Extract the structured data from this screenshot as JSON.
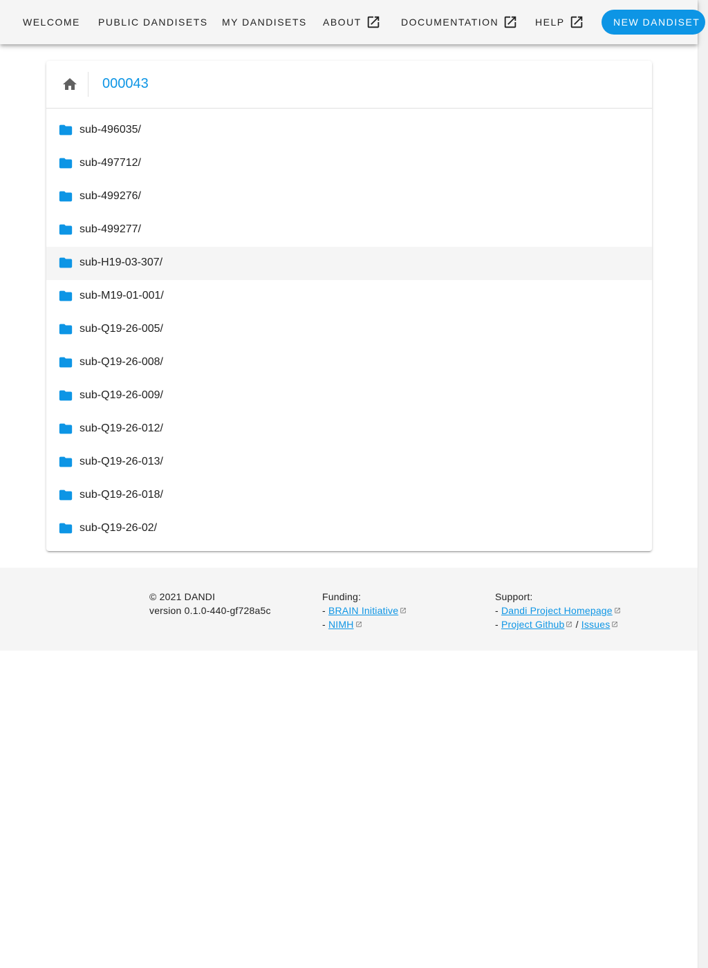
{
  "nav": {
    "items": [
      {
        "label": "WELCOME",
        "external": false
      },
      {
        "label": "PUBLIC DANDISETS",
        "external": false
      },
      {
        "label": "MY DANDISETS",
        "external": false
      },
      {
        "label": "ABOUT",
        "external": true
      },
      {
        "label": "DOCUMENTATION",
        "external": true
      },
      {
        "label": "HELP",
        "external": true
      }
    ],
    "new_dandiset_label": "NEW DANDISET"
  },
  "browser": {
    "breadcrumb": "000043",
    "items": [
      "sub-496035/",
      "sub-497712/",
      "sub-499276/",
      "sub-499277/",
      "sub-H19-03-307/",
      "sub-M19-01-001/",
      "sub-Q19-26-005/",
      "sub-Q19-26-008/",
      "sub-Q19-26-009/",
      "sub-Q19-26-012/",
      "sub-Q19-26-013/",
      "sub-Q19-26-018/",
      "sub-Q19-26-02/"
    ],
    "hovered_item": "sub-H19-03-307/"
  },
  "footer": {
    "copyright": "© 2021 DANDI",
    "version": "version 0.1.0-440-gf728a5c",
    "funding_title": "Funding:",
    "funding_links": [
      "BRAIN Initiative",
      "NIMH"
    ],
    "support_title": "Support:",
    "support_homepage": "Dandi Project Homepage",
    "support_github": "Project Github",
    "support_separator": "/",
    "support_issues": "Issues",
    "bullet": "-"
  },
  "colors": {
    "accent": "#0d95e5",
    "appbar_bg": "#f5f5f5",
    "text": "#212121",
    "icon_grey": "#616161"
  },
  "icons": {
    "external": "open-in-new-icon",
    "home": "home-icon",
    "folder": "folder-icon"
  }
}
